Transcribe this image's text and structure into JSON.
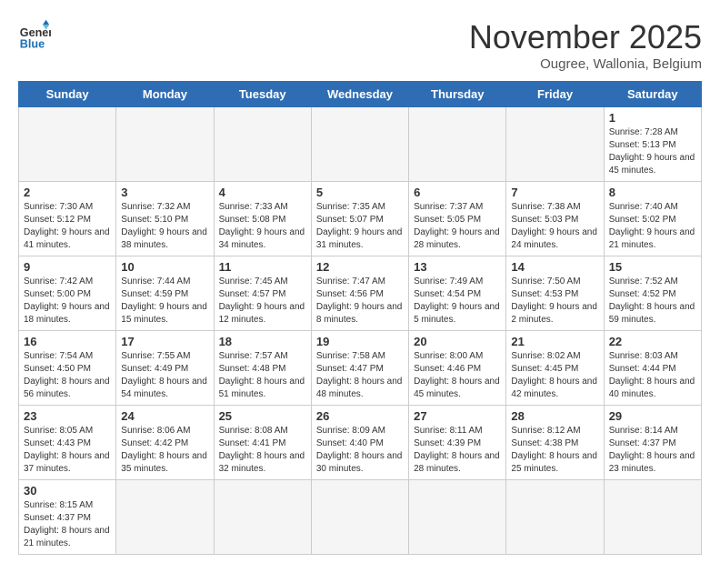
{
  "logo": {
    "line1": "General",
    "line2": "Blue"
  },
  "title": "November 2025",
  "subtitle": "Ougree, Wallonia, Belgium",
  "weekdays": [
    "Sunday",
    "Monday",
    "Tuesday",
    "Wednesday",
    "Thursday",
    "Friday",
    "Saturday"
  ],
  "weeks": [
    [
      {
        "day": "",
        "info": ""
      },
      {
        "day": "",
        "info": ""
      },
      {
        "day": "",
        "info": ""
      },
      {
        "day": "",
        "info": ""
      },
      {
        "day": "",
        "info": ""
      },
      {
        "day": "",
        "info": ""
      },
      {
        "day": "1",
        "info": "Sunrise: 7:28 AM\nSunset: 5:13 PM\nDaylight: 9 hours and 45 minutes."
      }
    ],
    [
      {
        "day": "2",
        "info": "Sunrise: 7:30 AM\nSunset: 5:12 PM\nDaylight: 9 hours and 41 minutes."
      },
      {
        "day": "3",
        "info": "Sunrise: 7:32 AM\nSunset: 5:10 PM\nDaylight: 9 hours and 38 minutes."
      },
      {
        "day": "4",
        "info": "Sunrise: 7:33 AM\nSunset: 5:08 PM\nDaylight: 9 hours and 34 minutes."
      },
      {
        "day": "5",
        "info": "Sunrise: 7:35 AM\nSunset: 5:07 PM\nDaylight: 9 hours and 31 minutes."
      },
      {
        "day": "6",
        "info": "Sunrise: 7:37 AM\nSunset: 5:05 PM\nDaylight: 9 hours and 28 minutes."
      },
      {
        "day": "7",
        "info": "Sunrise: 7:38 AM\nSunset: 5:03 PM\nDaylight: 9 hours and 24 minutes."
      },
      {
        "day": "8",
        "info": "Sunrise: 7:40 AM\nSunset: 5:02 PM\nDaylight: 9 hours and 21 minutes."
      }
    ],
    [
      {
        "day": "9",
        "info": "Sunrise: 7:42 AM\nSunset: 5:00 PM\nDaylight: 9 hours and 18 minutes."
      },
      {
        "day": "10",
        "info": "Sunrise: 7:44 AM\nSunset: 4:59 PM\nDaylight: 9 hours and 15 minutes."
      },
      {
        "day": "11",
        "info": "Sunrise: 7:45 AM\nSunset: 4:57 PM\nDaylight: 9 hours and 12 minutes."
      },
      {
        "day": "12",
        "info": "Sunrise: 7:47 AM\nSunset: 4:56 PM\nDaylight: 9 hours and 8 minutes."
      },
      {
        "day": "13",
        "info": "Sunrise: 7:49 AM\nSunset: 4:54 PM\nDaylight: 9 hours and 5 minutes."
      },
      {
        "day": "14",
        "info": "Sunrise: 7:50 AM\nSunset: 4:53 PM\nDaylight: 9 hours and 2 minutes."
      },
      {
        "day": "15",
        "info": "Sunrise: 7:52 AM\nSunset: 4:52 PM\nDaylight: 8 hours and 59 minutes."
      }
    ],
    [
      {
        "day": "16",
        "info": "Sunrise: 7:54 AM\nSunset: 4:50 PM\nDaylight: 8 hours and 56 minutes."
      },
      {
        "day": "17",
        "info": "Sunrise: 7:55 AM\nSunset: 4:49 PM\nDaylight: 8 hours and 54 minutes."
      },
      {
        "day": "18",
        "info": "Sunrise: 7:57 AM\nSunset: 4:48 PM\nDaylight: 8 hours and 51 minutes."
      },
      {
        "day": "19",
        "info": "Sunrise: 7:58 AM\nSunset: 4:47 PM\nDaylight: 8 hours and 48 minutes."
      },
      {
        "day": "20",
        "info": "Sunrise: 8:00 AM\nSunset: 4:46 PM\nDaylight: 8 hours and 45 minutes."
      },
      {
        "day": "21",
        "info": "Sunrise: 8:02 AM\nSunset: 4:45 PM\nDaylight: 8 hours and 42 minutes."
      },
      {
        "day": "22",
        "info": "Sunrise: 8:03 AM\nSunset: 4:44 PM\nDaylight: 8 hours and 40 minutes."
      }
    ],
    [
      {
        "day": "23",
        "info": "Sunrise: 8:05 AM\nSunset: 4:43 PM\nDaylight: 8 hours and 37 minutes."
      },
      {
        "day": "24",
        "info": "Sunrise: 8:06 AM\nSunset: 4:42 PM\nDaylight: 8 hours and 35 minutes."
      },
      {
        "day": "25",
        "info": "Sunrise: 8:08 AM\nSunset: 4:41 PM\nDaylight: 8 hours and 32 minutes."
      },
      {
        "day": "26",
        "info": "Sunrise: 8:09 AM\nSunset: 4:40 PM\nDaylight: 8 hours and 30 minutes."
      },
      {
        "day": "27",
        "info": "Sunrise: 8:11 AM\nSunset: 4:39 PM\nDaylight: 8 hours and 28 minutes."
      },
      {
        "day": "28",
        "info": "Sunrise: 8:12 AM\nSunset: 4:38 PM\nDaylight: 8 hours and 25 minutes."
      },
      {
        "day": "29",
        "info": "Sunrise: 8:14 AM\nSunset: 4:37 PM\nDaylight: 8 hours and 23 minutes."
      }
    ],
    [
      {
        "day": "30",
        "info": "Sunrise: 8:15 AM\nSunset: 4:37 PM\nDaylight: 8 hours and 21 minutes."
      },
      {
        "day": "",
        "info": ""
      },
      {
        "day": "",
        "info": ""
      },
      {
        "day": "",
        "info": ""
      },
      {
        "day": "",
        "info": ""
      },
      {
        "day": "",
        "info": ""
      },
      {
        "day": "",
        "info": ""
      }
    ]
  ]
}
